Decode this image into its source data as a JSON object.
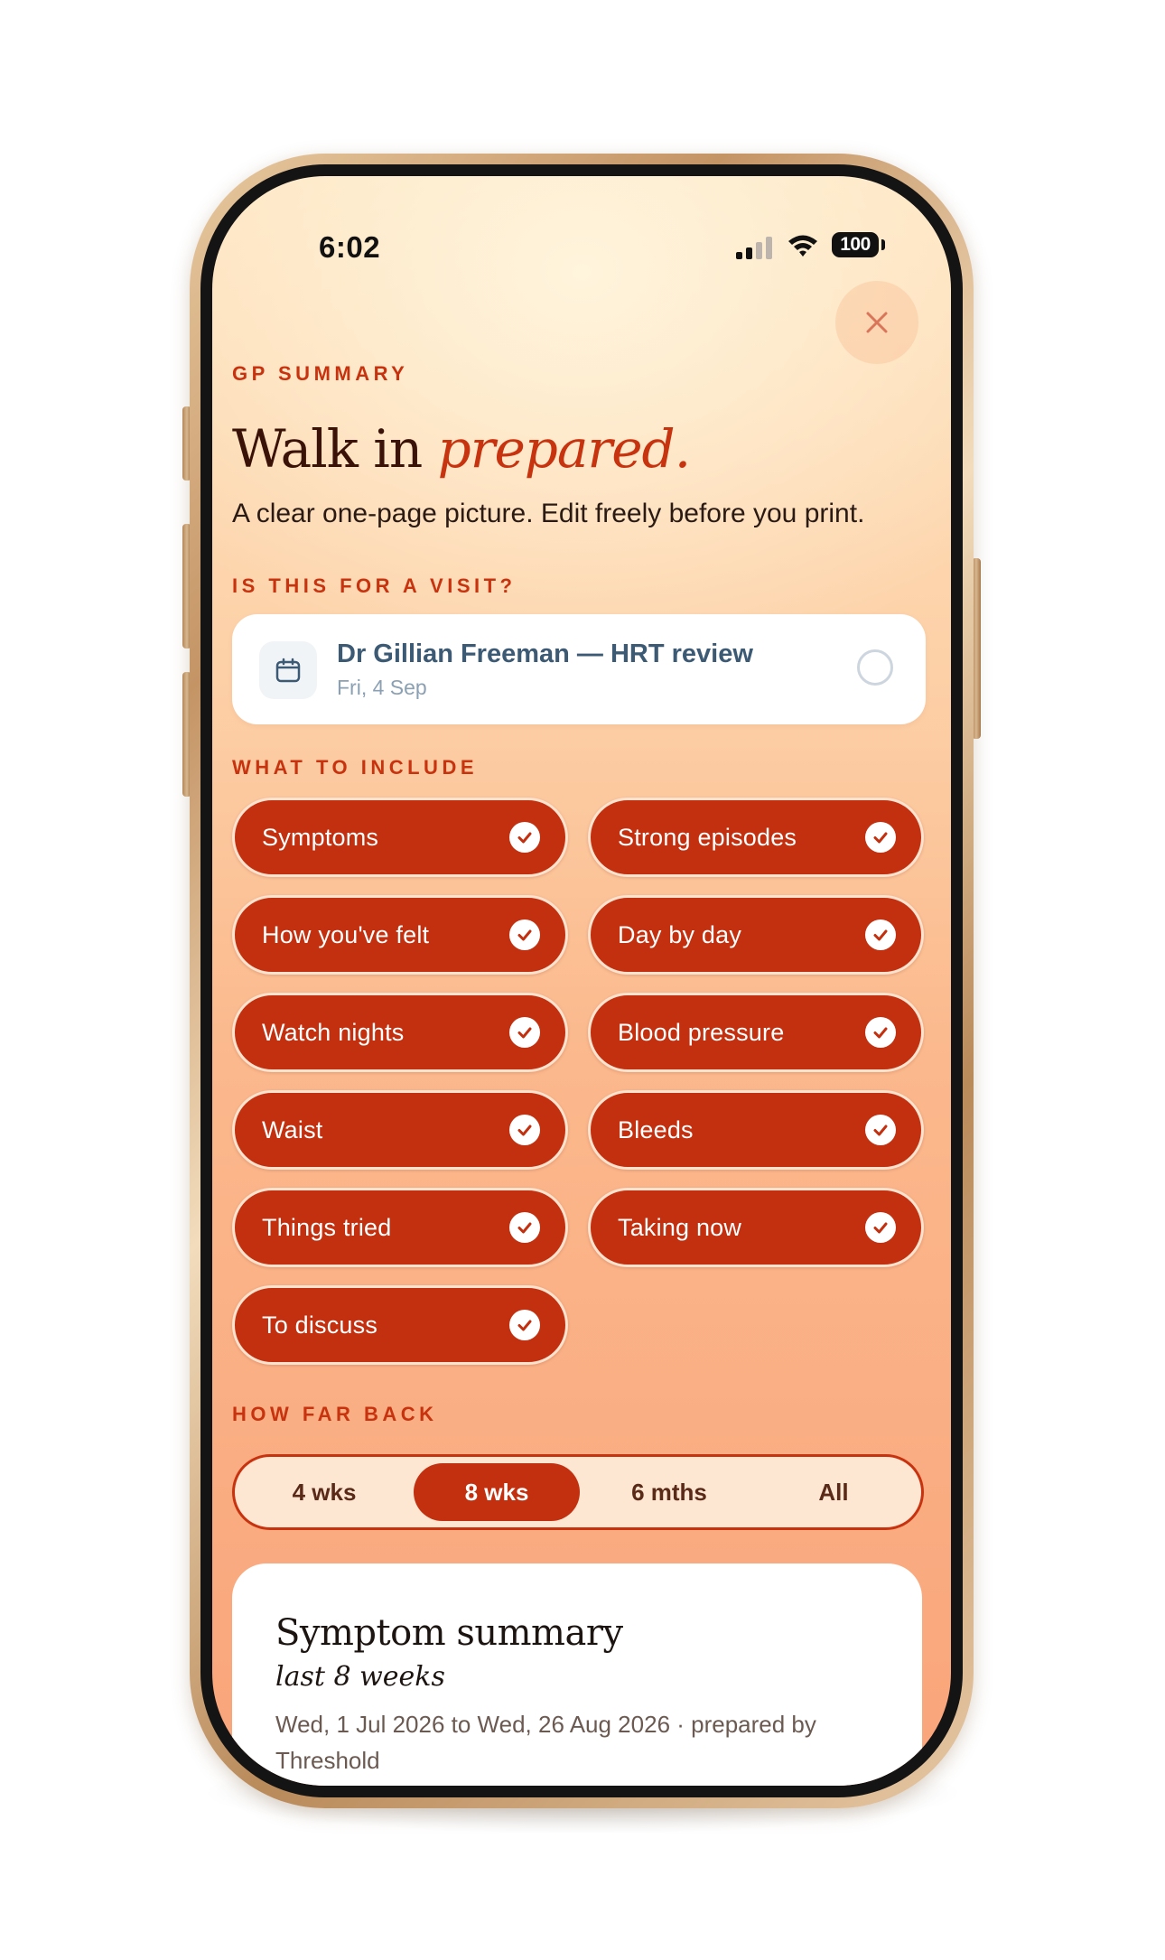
{
  "status_bar": {
    "time": "6:02",
    "battery": "100"
  },
  "header": {
    "eyebrow": "GP SUMMARY",
    "title_plain": "Walk in ",
    "title_accent": "prepared.",
    "subtitle": "A clear one-page picture. Edit freely before you print."
  },
  "visit": {
    "section_label": "IS THIS FOR A VISIT?",
    "title": "Dr Gillian Freeman — HRT review",
    "date": "Fri, 4 Sep",
    "icon": "calendar-icon",
    "selected": false
  },
  "include": {
    "section_label": "WHAT TO INCLUDE",
    "chips": [
      {
        "label": "Symptoms",
        "checked": true
      },
      {
        "label": "Strong episodes",
        "checked": true
      },
      {
        "label": "How you've felt",
        "checked": true
      },
      {
        "label": "Day by day",
        "checked": true
      },
      {
        "label": "Watch nights",
        "checked": true
      },
      {
        "label": "Blood pressure",
        "checked": true
      },
      {
        "label": "Waist",
        "checked": true
      },
      {
        "label": "Bleeds",
        "checked": true
      },
      {
        "label": "Things tried",
        "checked": true
      },
      {
        "label": "Taking now",
        "checked": true
      },
      {
        "label": "To discuss",
        "checked": true
      }
    ]
  },
  "range": {
    "section_label": "HOW FAR BACK",
    "options": [
      "4 wks",
      "8 wks",
      "6 mths",
      "All"
    ],
    "selected": "8 wks"
  },
  "summary": {
    "title": "Symptom summary",
    "period": "last 8 weeks",
    "range_text": "Wed, 1 Jul 2026 to Wed, 26 Aug 2026 · prepared by Threshold"
  },
  "colors": {
    "accent": "#c2300f",
    "heading": "#3a1208",
    "visit_text": "#3d5a75"
  }
}
